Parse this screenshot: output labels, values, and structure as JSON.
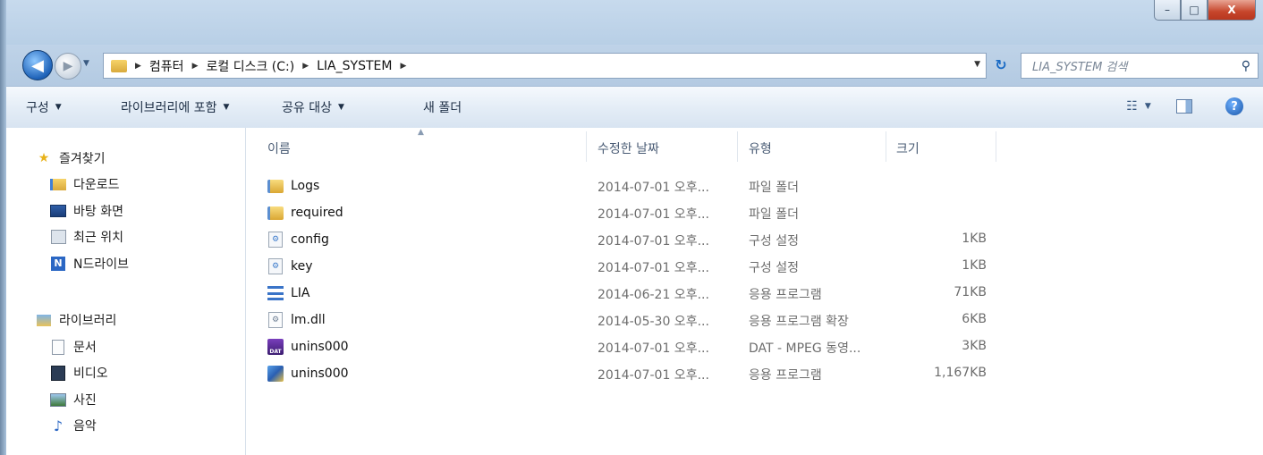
{
  "window": {
    "buttons": {
      "minimize": "–",
      "maximize": "□",
      "close": "X"
    }
  },
  "address_bar": {
    "breadcrumb": [
      "컴퓨터",
      "로컬 디스크 (C:)",
      "LIA_SYSTEM"
    ],
    "search_placeholder": "LIA_SYSTEM 검색"
  },
  "toolbar": {
    "organize": "구성",
    "include_in_library": "라이브러리에 포함",
    "share_with": "공유 대상",
    "new_folder": "새 폴더"
  },
  "sidebar": {
    "favorites": {
      "title": "즐겨찾기",
      "items": [
        {
          "label": "다운로드",
          "icon": "downloads-folder-icon"
        },
        {
          "label": "바탕 화면",
          "icon": "desktop-icon"
        },
        {
          "label": "최근 위치",
          "icon": "recent-places-icon"
        },
        {
          "label": "N드라이브",
          "icon": "ndrive-icon"
        }
      ]
    },
    "libraries": {
      "title": "라이브러리",
      "items": [
        {
          "label": "문서",
          "icon": "documents-icon"
        },
        {
          "label": "비디오",
          "icon": "videos-icon"
        },
        {
          "label": "사진",
          "icon": "pictures-icon"
        },
        {
          "label": "음악",
          "icon": "music-icon"
        }
      ]
    }
  },
  "file_list": {
    "columns": {
      "name": "이름",
      "modified": "수정한 날짜",
      "type": "유형",
      "size": "크기"
    },
    "rows": [
      {
        "name": "Logs",
        "modified": "2014-07-01 오후...",
        "type": "파일 폴더",
        "size": "",
        "icon": "folder"
      },
      {
        "name": "required",
        "modified": "2014-07-01 오후...",
        "type": "파일 폴더",
        "size": "",
        "icon": "folder"
      },
      {
        "name": "config",
        "modified": "2014-07-01 오후...",
        "type": "구성 설정",
        "size": "1KB",
        "icon": "config"
      },
      {
        "name": "key",
        "modified": "2014-07-01 오후...",
        "type": "구성 설정",
        "size": "1KB",
        "icon": "config"
      },
      {
        "name": "LIA",
        "modified": "2014-06-21 오후...",
        "type": "응용 프로그램",
        "size": "71KB",
        "icon": "app"
      },
      {
        "name": "lm.dll",
        "modified": "2014-05-30 오후...",
        "type": "응용 프로그램 확장",
        "size": "6KB",
        "icon": "dll"
      },
      {
        "name": "unins000",
        "modified": "2014-07-01 오후...",
        "type": "DAT - MPEG 동영...",
        "size": "3KB",
        "icon": "dat"
      },
      {
        "name": "unins000",
        "modified": "2014-07-01 오후...",
        "type": "응용 프로그램",
        "size": "1,167KB",
        "icon": "setup"
      }
    ]
  }
}
